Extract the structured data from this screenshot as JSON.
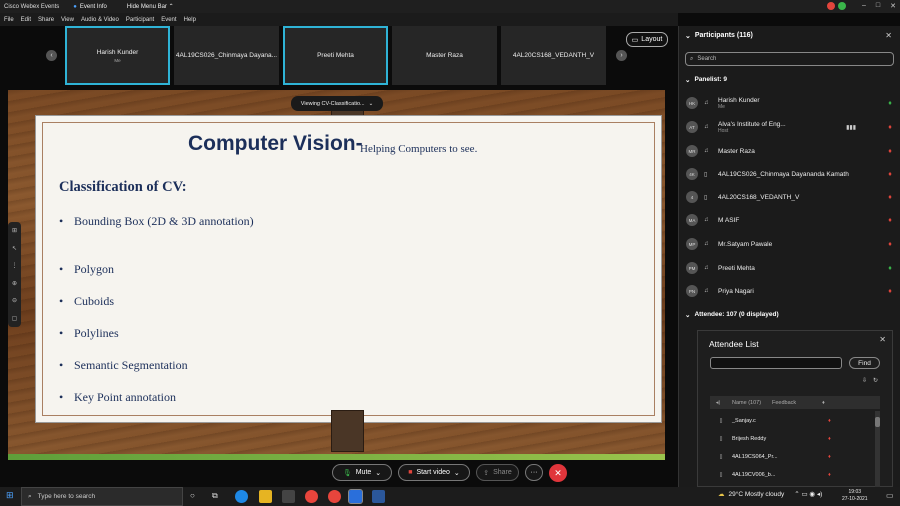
{
  "app": {
    "title": "Cisco Webex Events",
    "event_info": "Event Info",
    "hide_menu_bar": "Hide Menu Bar"
  },
  "menu": [
    "File",
    "Edit",
    "Share",
    "View",
    "Audio & Video",
    "Participant",
    "Event",
    "Help"
  ],
  "video_tiles": [
    {
      "name": "Harish Kunder",
      "sub": "Me",
      "selected": true
    },
    {
      "name": "4AL19CS026_Chinmaya Dayana...",
      "sub": "",
      "selected": false
    },
    {
      "name": "Preeti Mehta",
      "sub": "",
      "selected": true
    },
    {
      "name": "Master Raza",
      "sub": "",
      "selected": false
    },
    {
      "name": "4AL20CS168_VEDANTH_V",
      "sub": "",
      "selected": false
    }
  ],
  "layout_label": "Layout",
  "viewing_label": "Viewing CV-Classificatio...",
  "slide": {
    "title": "Computer Vision-",
    "subtitle": "Helping Computers to see.",
    "heading": "Classification of CV:",
    "bullets": [
      "Bounding Box (2D & 3D annotation)",
      "Polygon",
      "Cuboids",
      "Polylines",
      "Semantic Segmentation",
      "Key Point annotation"
    ]
  },
  "controls": {
    "mute": "Mute",
    "start_video": "Start video",
    "share": "Share",
    "more": "···"
  },
  "participants": {
    "header": "Participants (116)",
    "search_placeholder": "Search",
    "panelist_label": "Panelist: 9",
    "panelists": [
      {
        "initials": "HK",
        "name": "Harish Kunder",
        "role": "Me",
        "device": "headset",
        "mic": "on"
      },
      {
        "initials": "AT",
        "name": "Alva's Institute of Eng...",
        "role": "Host",
        "device": "headset",
        "mic": "off"
      },
      {
        "initials": "MR",
        "name": "Master Raza",
        "role": "",
        "device": "headset",
        "mic": "off"
      },
      {
        "initials": "4K",
        "name": "4AL19CS026_Chinmaya Dayananda Kamath",
        "role": "",
        "device": "phone",
        "mic": "off"
      },
      {
        "initials": "4",
        "name": "4AL20CS168_VEDANTH_V",
        "role": "",
        "device": "phone",
        "mic": "off"
      },
      {
        "initials": "MA",
        "name": "M ASIF",
        "role": "",
        "device": "headset",
        "mic": "off"
      },
      {
        "initials": "MP",
        "name": "Mr.Satyam Pawale",
        "role": "",
        "device": "headset",
        "mic": "off"
      },
      {
        "initials": "PM",
        "name": "Preeti Mehta",
        "role": "",
        "device": "headset",
        "mic": "on"
      },
      {
        "initials": "PN",
        "name": "Priya Nagari",
        "role": "",
        "device": "headset",
        "mic": "off"
      }
    ],
    "attendee_label": "Attendee: 107 (0 displayed)"
  },
  "attendee_list": {
    "title": "Attendee List",
    "find": "Find",
    "col_name": "Name (107)",
    "col_feedback": "Feedback",
    "rows": [
      "_Sanjay.c",
      "Brijesh Reddy",
      "4AL19CS064_Pr...",
      "4AL19CV006_b..."
    ]
  },
  "taskbar": {
    "search_placeholder": "Type here to search",
    "weather": "29°C  Mostly cloudy",
    "time": "19:03",
    "date": "27-10-2021"
  },
  "colors": {
    "accent": "#2fb3d6",
    "end": "#e0353b",
    "mic_on": "#3ab54a",
    "mic_off": "#e2453c"
  }
}
